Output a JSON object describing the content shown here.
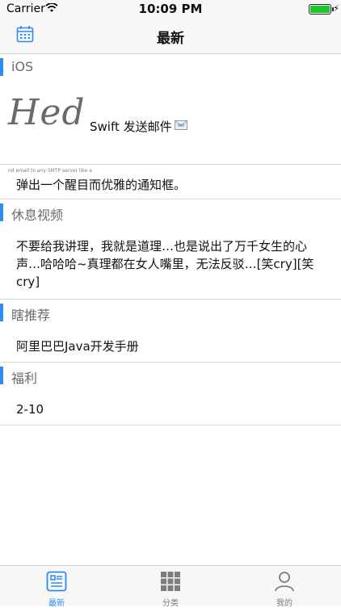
{
  "status_bar": {
    "carrier": "Carrier",
    "time": "10:09 PM",
    "battery_color": "#1fc62e"
  },
  "nav": {
    "title": "最新",
    "left_icon": "calendar-icon"
  },
  "sections": {
    "ios": {
      "label": "iOS",
      "hed_text": "Hed",
      "hed_subtext": "nd email to any SMTP server like a",
      "item_title": "Swift 发送邮件",
      "item_icon": "envelope-icon"
    },
    "ios_item2": {
      "title": "弹出一个醒目而优雅的通知框。"
    },
    "rest_video": {
      "label": "休息视频",
      "item_title": "不要给我讲理，我就是道理…也是说出了万千女生的心声…哈哈哈~真理都在女人嘴里，无法反驳…[笑cry][笑cry]"
    },
    "recommend": {
      "label": "瞎推荐",
      "item_title": "阿里巴巴Java开发手册"
    },
    "welfare": {
      "label": "福利",
      "item_title": "2-10"
    }
  },
  "tabbar": {
    "tabs": [
      {
        "label": "最新",
        "icon": "news-icon",
        "active": true
      },
      {
        "label": "分类",
        "icon": "grid-icon",
        "active": false
      },
      {
        "label": "我的",
        "icon": "person-icon",
        "active": false
      }
    ],
    "accent_color": "#2f8bea"
  }
}
